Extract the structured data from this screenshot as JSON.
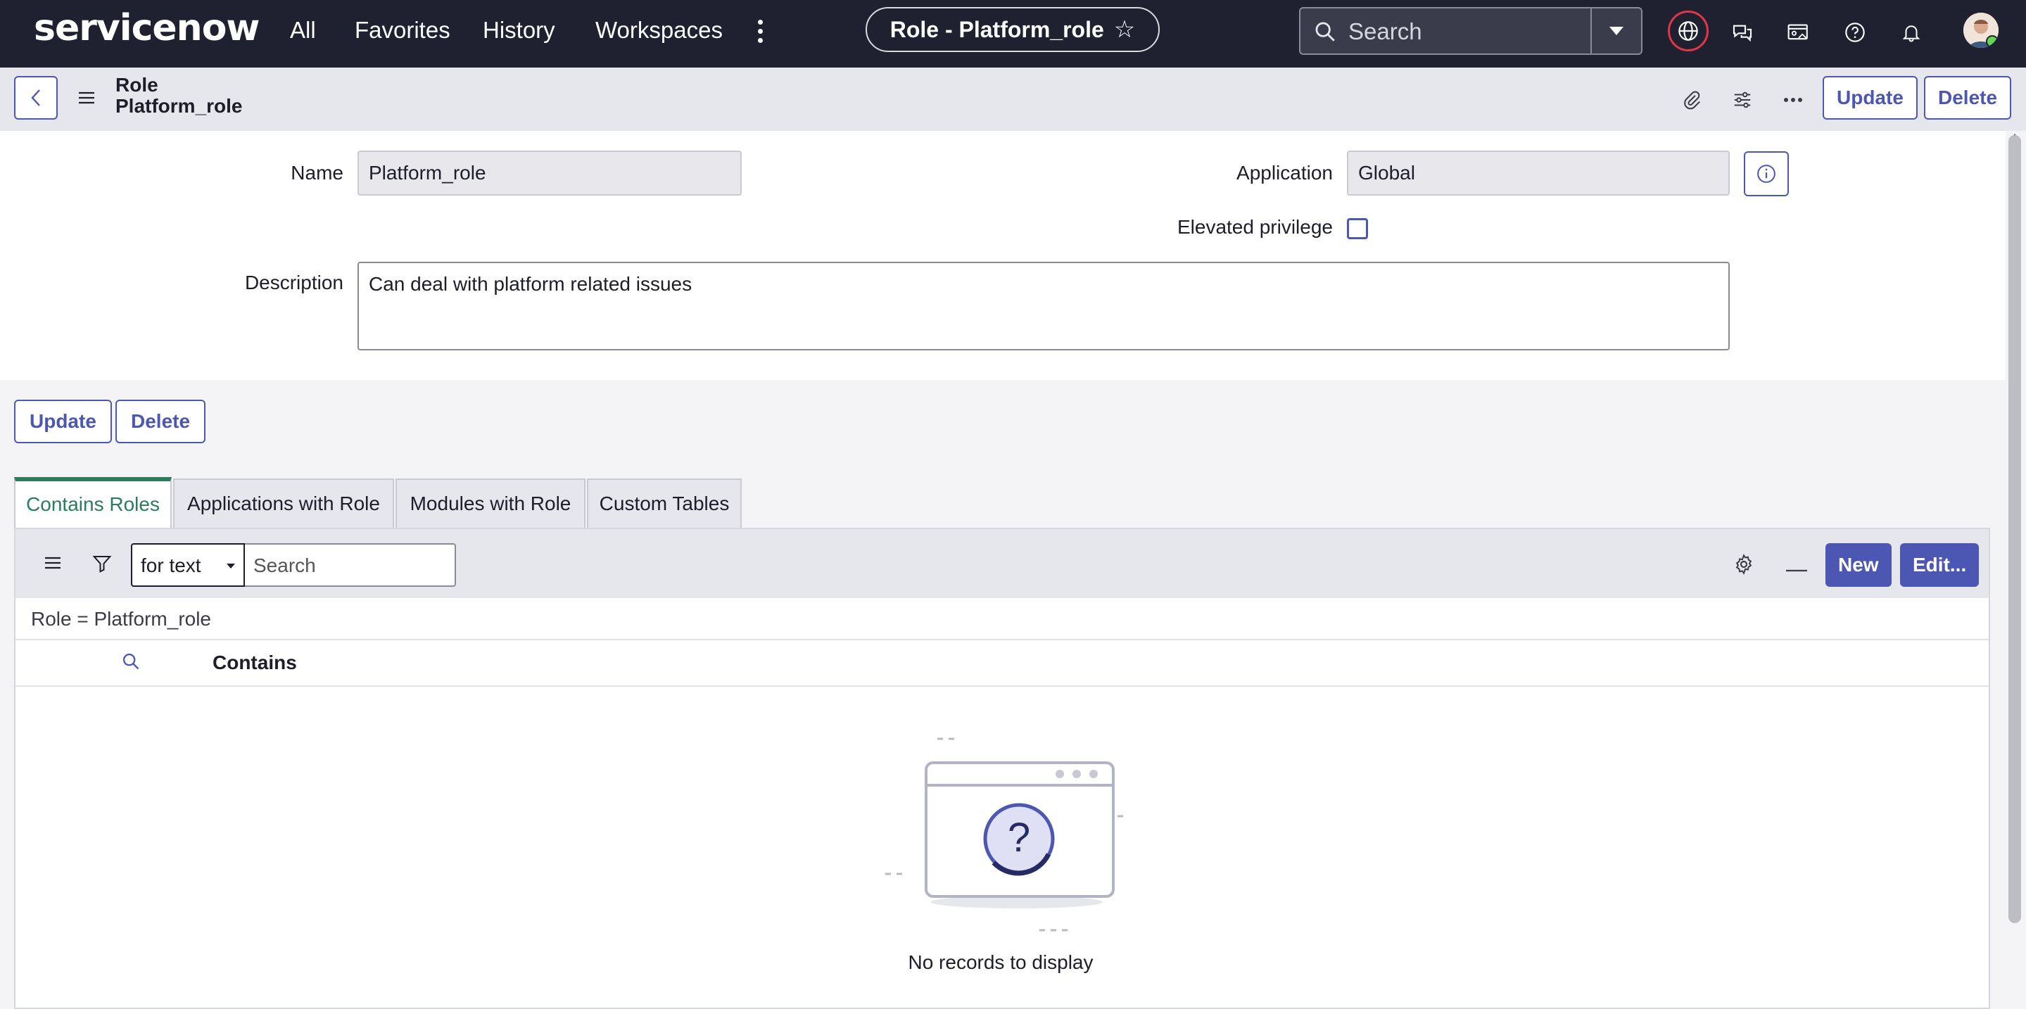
{
  "topnav": {
    "logo_text": "servicenow",
    "links": [
      "All",
      "Favorites",
      "History",
      "Workspaces"
    ],
    "context_pill": "Role - Platform_role",
    "search_placeholder": "Search"
  },
  "header": {
    "title_line1": "Role",
    "title_line2": "Platform_role",
    "update_label": "Update",
    "delete_label": "Delete"
  },
  "form": {
    "name_label": "Name",
    "name_value": "Platform_role",
    "application_label": "Application",
    "application_value": "Global",
    "elevated_label": "Elevated privilege",
    "elevated_checked": false,
    "description_label": "Description",
    "description_value": "Can deal with platform related issues"
  },
  "actions": {
    "update_label": "Update",
    "delete_label": "Delete"
  },
  "tabs": [
    {
      "label": "Contains Roles",
      "active": true
    },
    {
      "label": "Applications with Role",
      "active": false
    },
    {
      "label": "Modules with Role",
      "active": false
    },
    {
      "label": "Custom Tables",
      "active": false
    }
  ],
  "list": {
    "search_field": "for text",
    "search_placeholder": "Search",
    "new_label": "New",
    "edit_label": "Edit...",
    "breadcrumb": "Role = Platform_role",
    "column_header": "Contains",
    "empty_text": "No records to display"
  },
  "colors": {
    "nav_bg": "#1f2130",
    "accent": "#4c57b4",
    "tab_active": "#2b7d5b",
    "logo_green": "#62d84e"
  }
}
